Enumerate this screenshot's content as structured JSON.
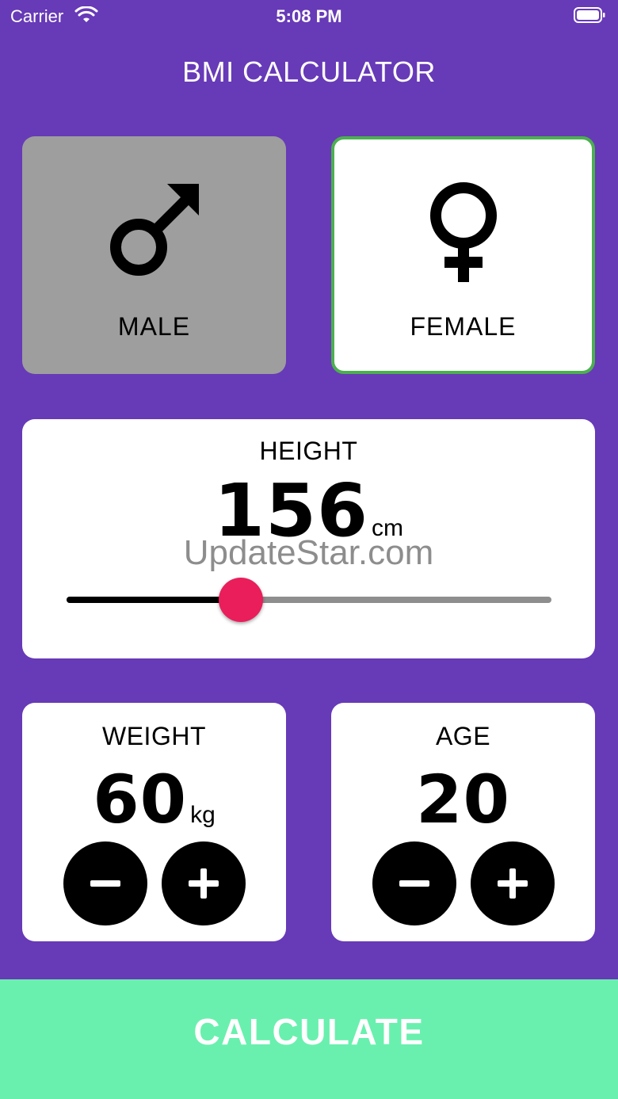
{
  "status_bar": {
    "carrier": "Carrier",
    "time": "5:08 PM"
  },
  "app": {
    "title": "BMI CALCULATOR"
  },
  "gender": {
    "male": {
      "label": "MALE",
      "icon": "male-symbol-icon",
      "selected": false
    },
    "female": {
      "label": "FEMALE",
      "icon": "female-symbol-icon",
      "selected": true
    }
  },
  "height": {
    "label": "HEIGHT",
    "value": "156",
    "unit": "cm",
    "slider_fraction": 0.36
  },
  "weight": {
    "label": "WEIGHT",
    "value": "60",
    "unit": "kg"
  },
  "age": {
    "label": "AGE",
    "value": "20"
  },
  "watermark": "UpdateStar.com",
  "calculate": {
    "label": "CALCULATE"
  },
  "colors": {
    "background": "#673ab7",
    "card": "#ffffff",
    "inactive_card": "#9e9e9e",
    "selected_border": "#4caf50",
    "slider_thumb": "#e91e5a",
    "calculate_button": "#69f0ae"
  }
}
